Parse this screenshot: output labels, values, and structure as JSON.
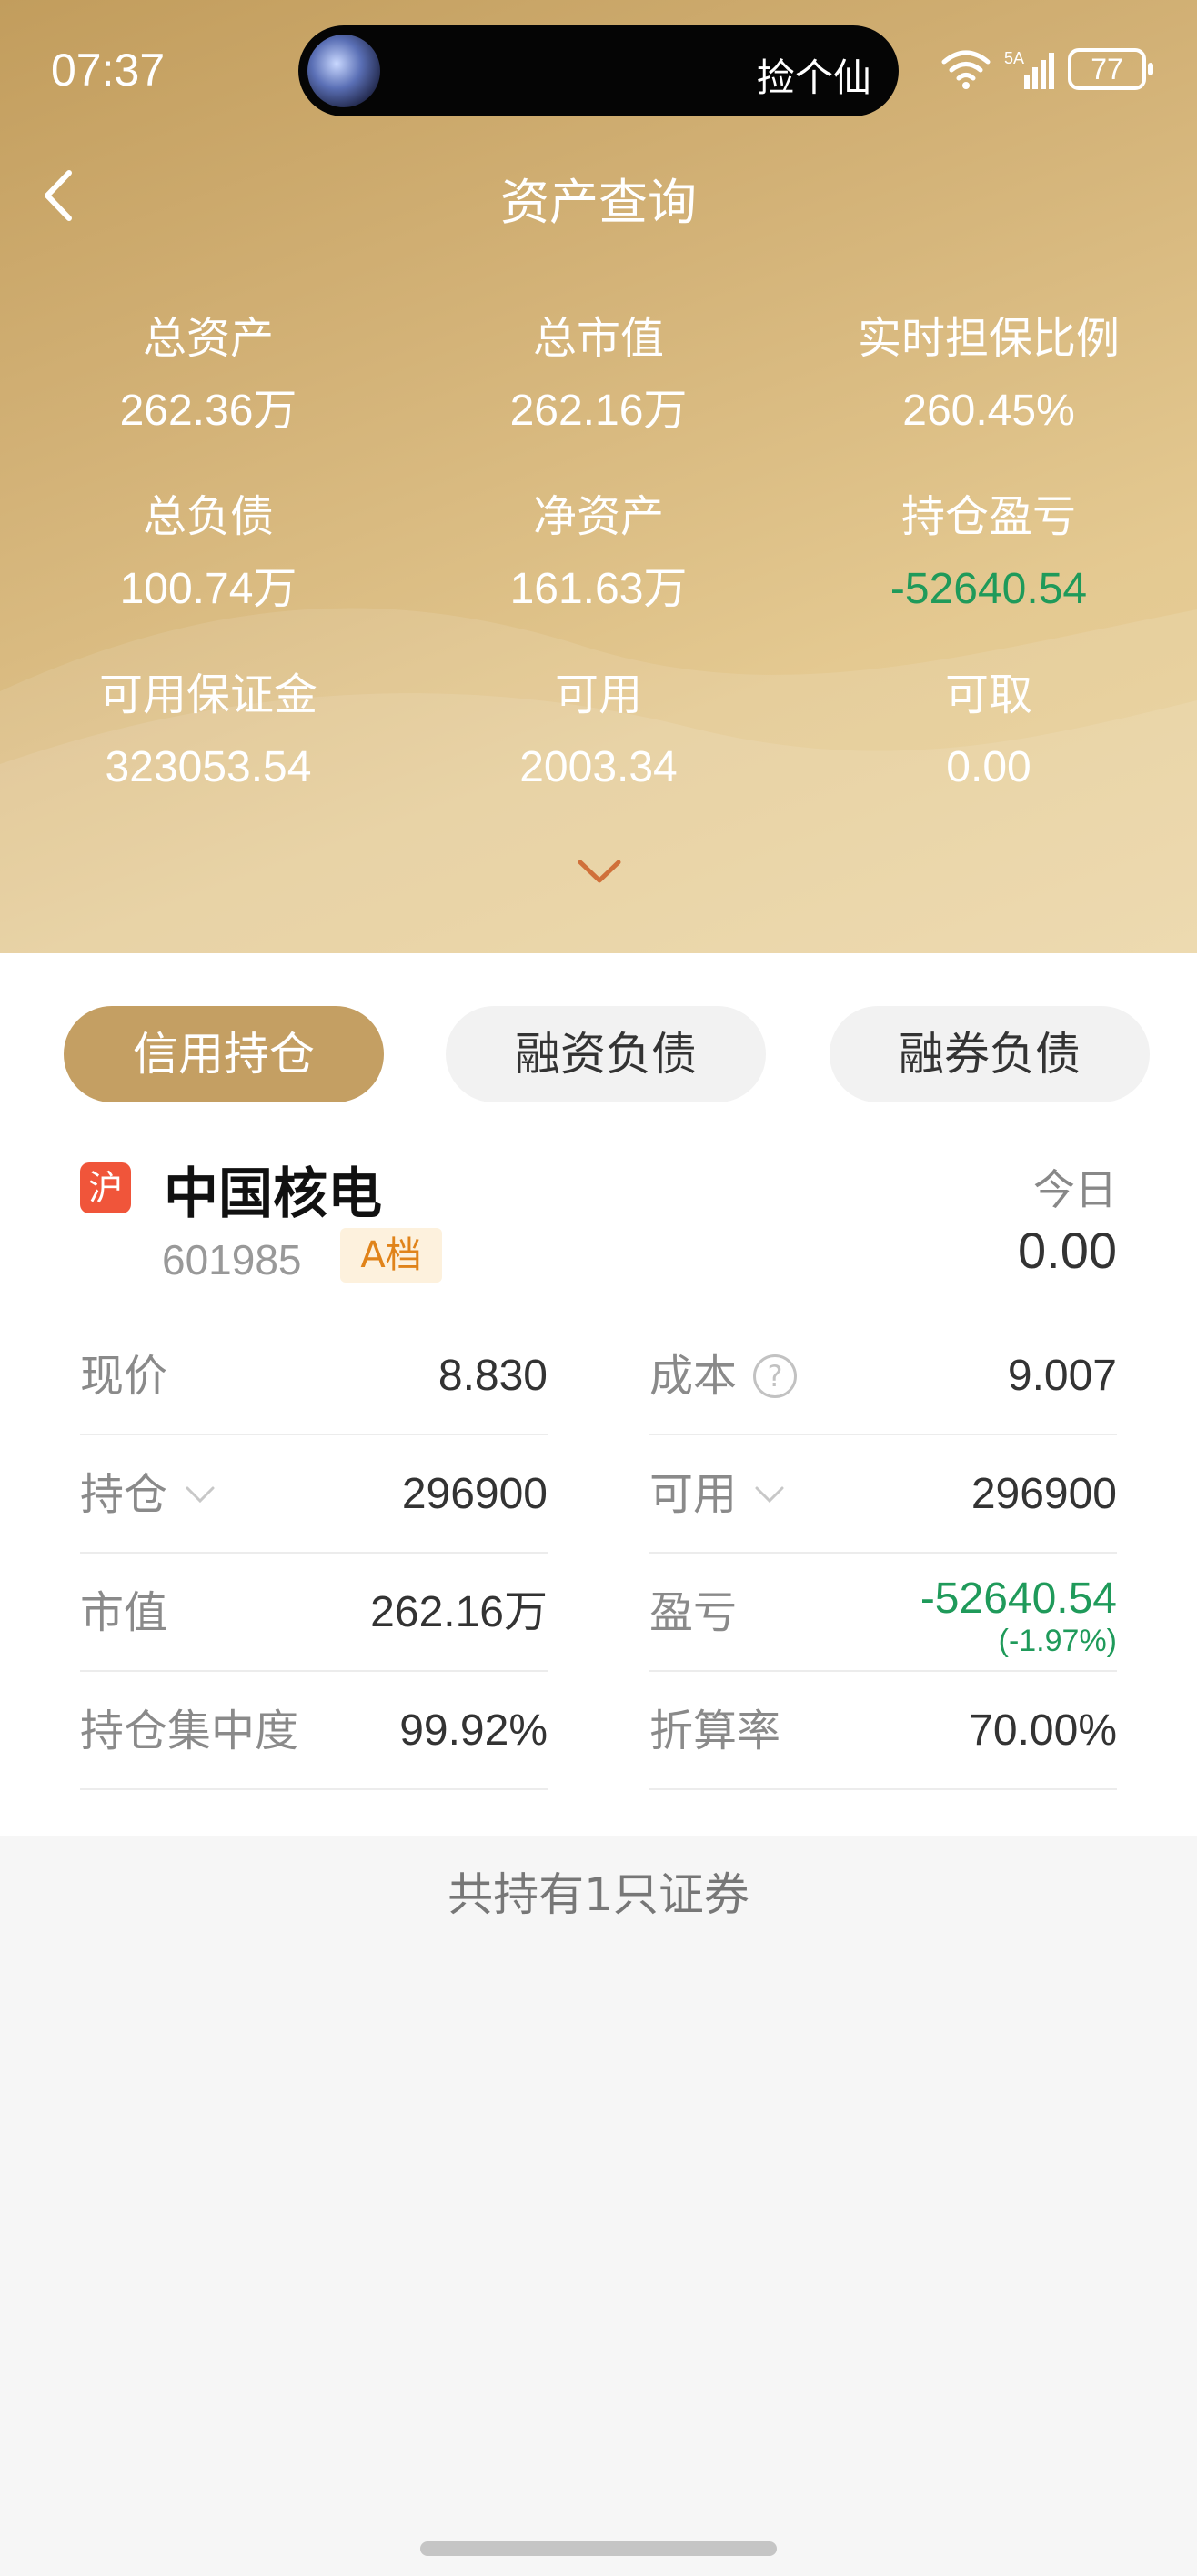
{
  "status_bar": {
    "time": "07:37",
    "island_text": "捡个仙",
    "battery": "77",
    "network": "5A"
  },
  "nav": {
    "title": "资产查询"
  },
  "stats": [
    {
      "label": "总资产",
      "value": "262.36万"
    },
    {
      "label": "总市值",
      "value": "262.16万"
    },
    {
      "label": "实时担保比例",
      "value": "260.45%"
    },
    {
      "label": "总负债",
      "value": "100.74万"
    },
    {
      "label": "净资产",
      "value": "161.63万"
    },
    {
      "label": "持仓盈亏",
      "value": "-52640.54"
    },
    {
      "label": "可用保证金",
      "value": "323053.54"
    },
    {
      "label": "可用",
      "value": "2003.34"
    },
    {
      "label": "可取",
      "value": "0.00"
    }
  ],
  "tabs": [
    {
      "label": "信用持仓",
      "active": true
    },
    {
      "label": "融资负债",
      "active": false
    },
    {
      "label": "融券负债",
      "active": false
    }
  ],
  "holding": {
    "exchange": "沪",
    "name": "中国核电",
    "code": "601985",
    "grade": "A档",
    "today_label": "今日",
    "today_value": "0.00",
    "fields": {
      "price": {
        "label": "现价",
        "value": "8.830"
      },
      "cost": {
        "label": "成本",
        "value": "9.007",
        "help": "?"
      },
      "position": {
        "label": "持仓",
        "value": "296900"
      },
      "available": {
        "label": "可用",
        "value": "296900"
      },
      "market_value": {
        "label": "市值",
        "value": "262.16万"
      },
      "pl": {
        "label": "盈亏",
        "value": "-52640.54",
        "percent": "(-1.97%)"
      },
      "concentration": {
        "label": "持仓集中度",
        "value": "99.92%"
      },
      "conversion": {
        "label": "折算率",
        "value": "70.00%"
      }
    }
  },
  "summary": "共持有1只证券",
  "colors": {
    "gold": "#c49f63",
    "loss_green": "#1f9a5a",
    "exchange_red": "#f0553a",
    "grade_orange": "#e0831a"
  }
}
